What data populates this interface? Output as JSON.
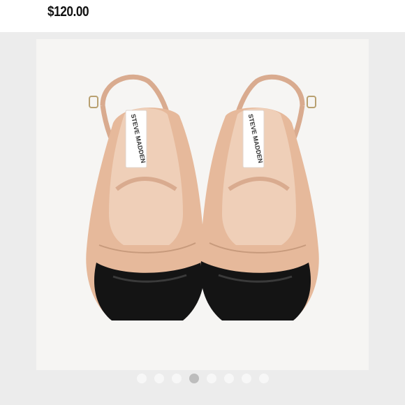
{
  "listing": {
    "price": "$120.00"
  },
  "gallery": {
    "image_label": "STEVE MADDEN",
    "dot_count": 8,
    "active_index": 3
  }
}
